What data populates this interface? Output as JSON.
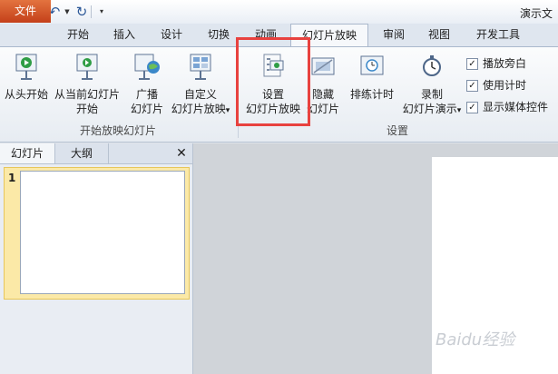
{
  "window": {
    "title": "演示文"
  },
  "qat": {
    "app_logo": "P",
    "more": "▾"
  },
  "tabs": [
    {
      "label": "文件"
    },
    {
      "label": "开始"
    },
    {
      "label": "插入"
    },
    {
      "label": "设计"
    },
    {
      "label": "切换"
    },
    {
      "label": "动画"
    },
    {
      "label": "幻灯片放映"
    },
    {
      "label": "审阅"
    },
    {
      "label": "视图"
    },
    {
      "label": "开发工具"
    }
  ],
  "ribbon": {
    "group1": {
      "label": "开始放映幻灯片",
      "from_start": "从头开始",
      "from_current_1": "从当前幻灯片",
      "from_current_2": "开始",
      "broadcast_1": "广播",
      "broadcast_2": "幻灯片",
      "custom_1": "自定义",
      "custom_2": "幻灯片放映",
      "custom_dropdown": "▾"
    },
    "group2": {
      "label": "设置",
      "setup_1": "设置",
      "setup_2": "幻灯片放映",
      "hide_1": "隐藏",
      "hide_2": "幻灯片",
      "rehearse": "排练计时",
      "record_1": "录制",
      "record_2": "幻灯片演示",
      "record_dropdown": "▾",
      "checkboxes": [
        {
          "label": "播放旁白",
          "checked": true,
          "mark": "✓"
        },
        {
          "label": "使用计时",
          "checked": true,
          "mark": "✓"
        },
        {
          "label": "显示媒体控件",
          "checked": true,
          "mark": "✓"
        }
      ]
    }
  },
  "pane": {
    "tabs": [
      {
        "label": "幻灯片"
      },
      {
        "label": "大纲"
      }
    ],
    "close": "✕",
    "slide_number": "1"
  },
  "watermark": "Baidu经验",
  "colors": {
    "file_tab": "#d24726",
    "highlight": "#e8423f",
    "selected_thumb": "#fbe9a7"
  }
}
